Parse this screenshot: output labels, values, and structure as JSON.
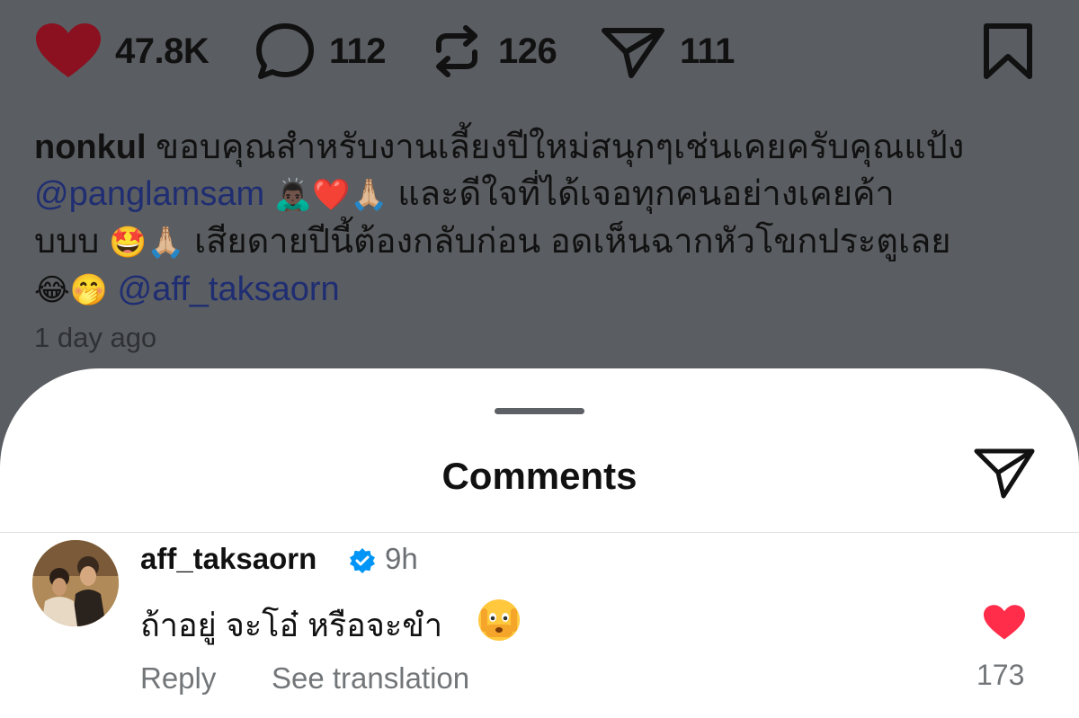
{
  "post": {
    "likes": "47.8K",
    "comments": "112",
    "reposts": "126",
    "shares": "111",
    "caption": {
      "username": "nonkul",
      "line1_text": "ขอบคุณสำหรับงานเลี้ยงปีใหม่สนุกๆเช่นเคยครับคุณแป้ง",
      "mention1": "@panglamsam",
      "line2_emoji": "🙇🏿‍♂️❤️🙏🏼",
      "line2_text": "และดีใจที่ได้เจอทุกคนอย่างเคยค้า",
      "line3_text_a": "บบบ",
      "line3_emoji": "🤩🙏🏼",
      "line3_text_b": "เสียดายปีนี้ต้องกลับก่อน อดเห็นฉากหัวโขกประตูเลย",
      "line4_emoji": "😂🤭",
      "mention2": "@aff_taksaorn"
    },
    "time": "1 day ago"
  },
  "sheet": {
    "title": "Comments"
  },
  "comment": {
    "username": "aff_taksaorn",
    "time": "9h",
    "text": "ถ้าอยู่ จะโอ๋ หรือจะขำ",
    "reply_label": "Reply",
    "translate_label": "See translation",
    "like_count": "173"
  },
  "icons": {
    "like": "heart-icon",
    "comment": "speech-bubble-icon",
    "repost": "repost-icon",
    "share": "paper-plane-icon",
    "save": "bookmark-icon",
    "verified": "verified-badge-icon",
    "emoji": "face-peeking-icon"
  },
  "colors": {
    "like_red": "#8b1020",
    "comment_like_red": "#ff2d49",
    "mention_blue": "#1f2d72",
    "verified_blue": "#0095f6",
    "overlay_gray": "#5a5d61"
  }
}
